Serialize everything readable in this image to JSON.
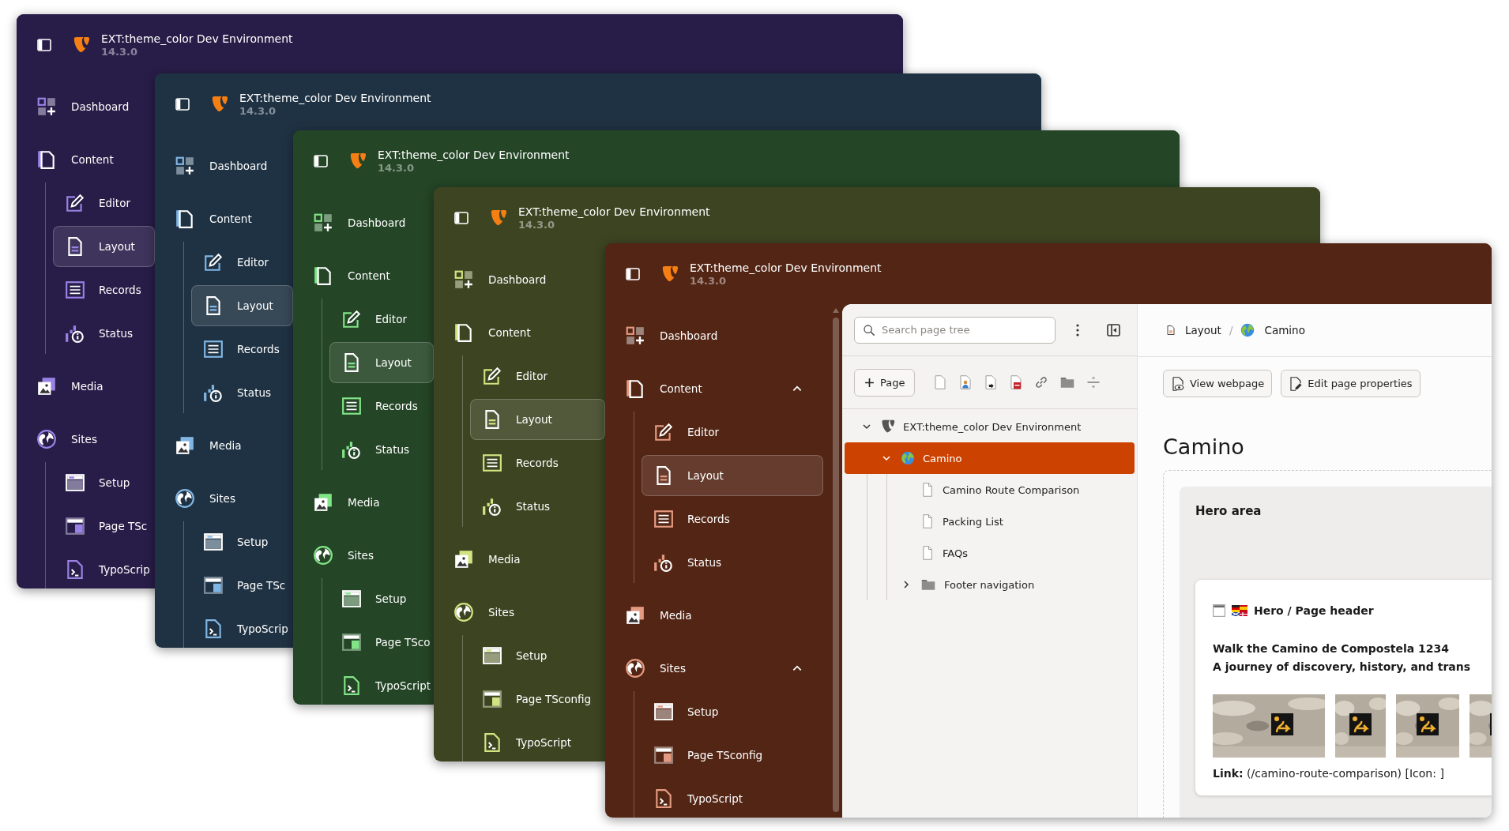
{
  "windows": [
    {
      "color": "#281d48",
      "title": "EXT:theme_color Dev Environment",
      "version": "14.3.0",
      "sidebar": [
        {
          "label": "Dashboard",
          "selected": false
        },
        {
          "label": "Content",
          "selected": false,
          "children": [
            {
              "label": "Editor",
              "selected": false
            },
            {
              "label": "Layout",
              "selected": true
            },
            {
              "label": "Records",
              "selected": false
            },
            {
              "label": "Status",
              "selected": false
            }
          ]
        },
        {
          "label": "Media",
          "selected": false
        },
        {
          "label": "Sites",
          "selected": false,
          "children": [
            {
              "label": "Setup",
              "selected": false
            },
            {
              "label": "Page TSc",
              "selected": false
            },
            {
              "label": "TypoScrip",
              "selected": false
            }
          ]
        }
      ]
    },
    {
      "color": "#1f3243",
      "title": "EXT:theme_color Dev Environment",
      "version": "14.3.0",
      "sidebar": [
        {
          "label": "Dashboard",
          "selected": false
        },
        {
          "label": "Content",
          "selected": false,
          "children": [
            {
              "label": "Editor",
              "selected": false
            },
            {
              "label": "Layout",
              "selected": true
            },
            {
              "label": "Records",
              "selected": false
            },
            {
              "label": "Status",
              "selected": false
            }
          ]
        },
        {
          "label": "Media",
          "selected": false
        },
        {
          "label": "Sites",
          "selected": false,
          "children": [
            {
              "label": "Setup",
              "selected": false
            },
            {
              "label": "Page TSc",
              "selected": false
            },
            {
              "label": "TypoScrip",
              "selected": false
            }
          ]
        }
      ]
    },
    {
      "color": "#244526",
      "title": "EXT:theme_color Dev Environment",
      "version": "14.3.0",
      "sidebar": [
        {
          "label": "Dashboard",
          "selected": false
        },
        {
          "label": "Content",
          "selected": false,
          "children": [
            {
              "label": "Editor",
              "selected": false
            },
            {
              "label": "Layout",
              "selected": true
            },
            {
              "label": "Records",
              "selected": false
            },
            {
              "label": "Status",
              "selected": false
            }
          ]
        },
        {
          "label": "Media",
          "selected": false
        },
        {
          "label": "Sites",
          "selected": false,
          "children": [
            {
              "label": "Setup",
              "selected": false
            },
            {
              "label": "Page TSco",
              "selected": false
            },
            {
              "label": "TypoScript",
              "selected": false
            }
          ]
        }
      ]
    },
    {
      "color": "#3d4422",
      "title": "EXT:theme_color Dev Environment",
      "version": "14.3.0",
      "sidebar": [
        {
          "label": "Dashboard",
          "selected": false
        },
        {
          "label": "Content",
          "selected": false,
          "children": [
            {
              "label": "Editor",
              "selected": false
            },
            {
              "label": "Layout",
              "selected": true
            },
            {
              "label": "Records",
              "selected": false
            },
            {
              "label": "Status",
              "selected": false
            }
          ]
        },
        {
          "label": "Media",
          "selected": false
        },
        {
          "label": "Sites",
          "selected": false,
          "children": [
            {
              "label": "Setup",
              "selected": false
            },
            {
              "label": "Page TSconfig",
              "selected": false
            },
            {
              "label": "TypoScript",
              "selected": false
            }
          ]
        }
      ]
    },
    {
      "color": "#532515",
      "title": "EXT:theme_color Dev Environment",
      "version": "14.3.0",
      "sidebar": [
        {
          "label": "Dashboard",
          "selected": false
        },
        {
          "label": "Content",
          "selected": false,
          "expanded": true,
          "children": [
            {
              "label": "Editor",
              "selected": false
            },
            {
              "label": "Layout",
              "selected": true
            },
            {
              "label": "Records",
              "selected": false
            },
            {
              "label": "Status",
              "selected": false
            }
          ]
        },
        {
          "label": "Media",
          "selected": false
        },
        {
          "label": "Sites",
          "selected": false,
          "expanded": true,
          "children": [
            {
              "label": "Setup",
              "selected": false
            },
            {
              "label": "Page TSconfig",
              "selected": false
            },
            {
              "label": "TypoScript",
              "selected": false
            }
          ]
        }
      ],
      "page_tree": {
        "search": {
          "placeholder": "Search page tree"
        },
        "new_button": "Page",
        "nodes": [
          {
            "kind": "root",
            "label": "EXT:theme_color Dev Environment",
            "selected": false,
            "expanded": true,
            "children": [
              {
                "kind": "site",
                "label": "Camino",
                "selected": true,
                "expanded": true,
                "children": [
                  {
                    "kind": "page",
                    "label": "Camino Route Comparison",
                    "selected": false
                  },
                  {
                    "kind": "page",
                    "label": "Packing List",
                    "selected": false
                  },
                  {
                    "kind": "page",
                    "label": "FAQs",
                    "selected": false
                  },
                  {
                    "kind": "folder",
                    "label": "Footer navigation",
                    "selected": false,
                    "expanded": false
                  }
                ]
              }
            ]
          }
        ]
      },
      "content": {
        "breadcrumb": {
          "items": [
            {
              "kind": "module",
              "label": "Layout"
            },
            {
              "kind": "site",
              "label": "Camino"
            }
          ],
          "separator": "/"
        },
        "buttons": [
          "View webpage",
          "Edit page properties"
        ],
        "heading": "Camino",
        "area": {
          "title": "Hero area",
          "element": {
            "title": "Hero / Page header",
            "lines": [
              "Walk the Camino de Compostela 1234",
              "A journey of discovery, history, and trans"
            ],
            "images": [
              {
                "kind": "picture"
              },
              {
                "kind": "picture"
              },
              {
                "kind": "picture"
              },
              {
                "kind": "picture"
              }
            ],
            "link": "**Link:** (/camino-route-comparison) [Icon: ]"
          }
        }
      }
    }
  ]
}
